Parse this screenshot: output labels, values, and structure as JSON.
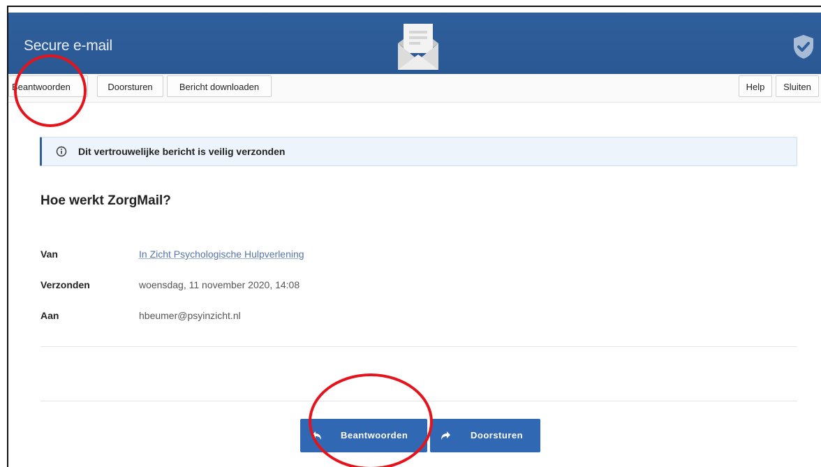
{
  "app": {
    "title": "Secure e-mail"
  },
  "toolbar": {
    "reply_label": "Beantwoorden",
    "forward_label": "Doorsturen",
    "download_label": "Bericht downloaden",
    "help_label": "Help",
    "close_label": "Sluiten"
  },
  "alert": {
    "text": "Dit vertrouwelijke bericht is veilig verzonden"
  },
  "message": {
    "subject": "Hoe werkt ZorgMail?",
    "from_label": "Van",
    "from_value": "In Zicht Psychologische Hulpverlening",
    "sent_label": "Verzonden",
    "sent_value": "woensdag, 11 november 2020, 14:08",
    "to_label": "Aan",
    "to_value": "hbeumer@psyinzicht.nl"
  },
  "actions": {
    "reply_label": "Beantwoorden",
    "forward_label": "Doorsturen"
  },
  "colors": {
    "header": "#2f5f9c",
    "action_button": "#3168b4",
    "annotation": "#e3141b"
  },
  "icons": [
    "envelope-icon",
    "shield-check-icon",
    "info-icon",
    "reply-icon",
    "forward-icon"
  ]
}
